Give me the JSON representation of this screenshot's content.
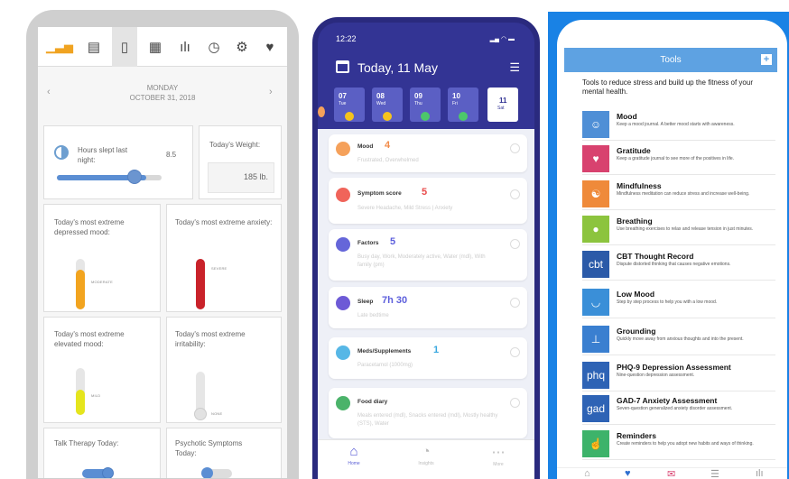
{
  "mood_tracker": {
    "toolbar_icons": [
      "bar-chart-icon",
      "table-icon",
      "clipboard-icon",
      "grid-icon",
      "bars-icon",
      "clock-icon",
      "gear-icon",
      "heart-icon"
    ],
    "date": {
      "weekday": "MONDAY",
      "date": "OCTOBER 31, 2018"
    },
    "hours_slept": {
      "label": "Hours slept last night:",
      "value": "8.5",
      "level": 0.85
    },
    "weight": {
      "label": "Today's Weight:",
      "value": "185 lb."
    },
    "depressed": {
      "label": "Today's most extreme depressed mood:",
      "level_label": "MODERATE",
      "color": "#f2a41f"
    },
    "anxiety": {
      "label": "Today's most extreme anxiety:",
      "level_label": "SEVERE",
      "color": "#c9222a"
    },
    "elevated": {
      "label": "Today's most extreme elevated mood:",
      "level_label": "MILD",
      "color": "#e5e51d"
    },
    "irritability": {
      "label": "Today's most extreme irritability:",
      "level_label": "NONE"
    },
    "therapy": {
      "label": "Talk Therapy Today:"
    },
    "psychotic": {
      "label": "Psychotic Symptoms Today:"
    }
  },
  "daily_log": {
    "status_time": "12:22",
    "title": "Today, 11 May",
    "days": [
      {
        "num": "07",
        "wd": "Tue",
        "color": "#f5c31d"
      },
      {
        "num": "08",
        "wd": "Wed",
        "color": "#f5c31d"
      },
      {
        "num": "09",
        "wd": "Thu",
        "color": "#4cc76b"
      },
      {
        "num": "10",
        "wd": "Fri",
        "color": "#4cc76b"
      },
      {
        "num": "11",
        "wd": "Sat",
        "color": ""
      }
    ],
    "items": [
      {
        "title": "Mood",
        "value": "4",
        "sub": "Frustrated, Overwhelmed",
        "color": "#f5a15b",
        "vcolor": "#f28c4a"
      },
      {
        "title": "Symptom score",
        "value": "5",
        "sub": "Severe Headache, Mild Stress | Anxiety",
        "color": "#f0645a",
        "vcolor": "#e94c4c"
      },
      {
        "title": "Factors",
        "value": "5",
        "sub": "Busy day, Work, Moderately active, Water (mdl), With family (pm)",
        "color": "#6566d9",
        "vcolor": "#5d5fdc"
      },
      {
        "title": "Sleep",
        "value": "7h 30",
        "sub": "Late bedtime",
        "color": "#6d5ad6",
        "vcolor": "#5d5fdc"
      },
      {
        "title": "Meds/Supplements",
        "value": "1",
        "sub": "Paracetamol (1000mg)",
        "color": "#57b7e6",
        "vcolor": "#3aa8e0"
      },
      {
        "title": "Food diary",
        "value": "",
        "sub": "Meals entered (mdl), Snacks entered (mdl), Mostly healthy (STS), Water",
        "color": "#4bb36a",
        "vcolor": "#333"
      }
    ],
    "nav": [
      {
        "label": "Home",
        "icon": "home-icon"
      },
      {
        "label": "Insights",
        "icon": "chart-icon"
      },
      {
        "label": "More",
        "icon": "more-icon"
      }
    ]
  },
  "tools": {
    "header": "Tools",
    "intro": "Tools to reduce stress and build up the fitness of your mental health.",
    "items": [
      {
        "name": "Mood",
        "desc": "Keep a mood journal. A better mood starts with awareness.",
        "color": "#4f8fd6",
        "icon": "☺"
      },
      {
        "name": "Gratitude",
        "desc": "Keep a gratitude journal to see more of the positives in life.",
        "color": "#d8426f",
        "icon": "♥"
      },
      {
        "name": "Mindfulness",
        "desc": "Mindfulness meditation can reduce stress and increase well-being.",
        "color": "#ef8a3a",
        "icon": "☯"
      },
      {
        "name": "Breathing",
        "desc": "Use breathing exercises to relax and release tension in just minutes.",
        "color": "#8cc43e",
        "icon": "●"
      },
      {
        "name": "CBT Thought Record",
        "desc": "Dispute distorted thinking that causes negative emotions.",
        "color": "#2b5aa8",
        "icon": "cbt"
      },
      {
        "name": "Low Mood",
        "desc": "Step by step process to help you with a low mood.",
        "color": "#3a8fd8",
        "icon": "◡"
      },
      {
        "name": "Grounding",
        "desc": "Quickly move away from anxious thoughts and into the present.",
        "color": "#3a7fd0",
        "icon": "⊥"
      },
      {
        "name": "PHQ-9 Depression Assessment",
        "desc": "Nine-question depression assessment.",
        "color": "#2e63b5",
        "icon": "phq"
      },
      {
        "name": "GAD-7 Anxiety Assessment",
        "desc": "Seven-question generalized anxiety disorder assessment.",
        "color": "#2e63b5",
        "icon": "gad"
      },
      {
        "name": "Reminders",
        "desc": "Create reminders to help you adopt new habits and ways of thinking.",
        "color": "#3db36a",
        "icon": "☝"
      }
    ]
  }
}
